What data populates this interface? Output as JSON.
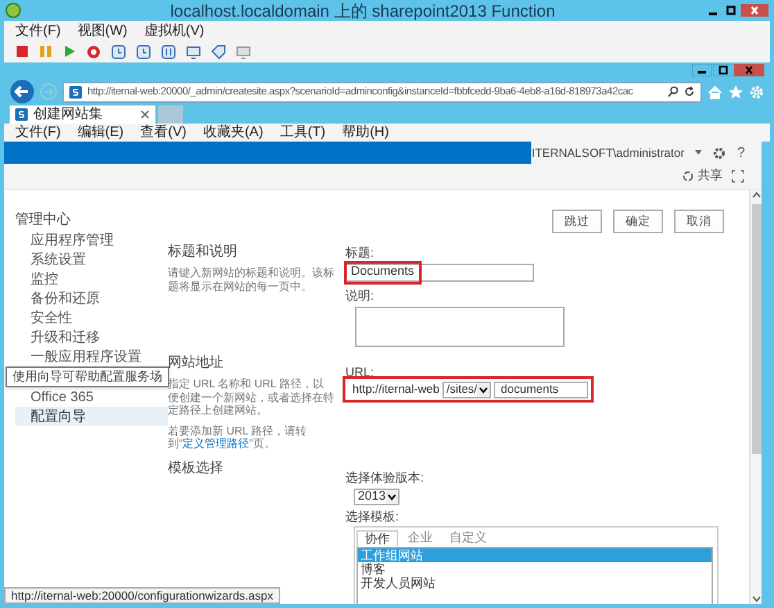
{
  "vm_window": {
    "title": "localhost.localdomain 上的 sharepoint2013 Function",
    "menu": [
      "文件(F)",
      "视图(W)",
      "虚拟机(V)"
    ]
  },
  "browser": {
    "url": "http://iternal-web:20000/_admin/createsite.aspx?scenarioId=adminconfig&instanceId=fbbfcedd-9ba6-4eb8-a16d-818973a42cac",
    "tabs": [
      {
        "label": "创建网站集",
        "selected": true
      }
    ],
    "menu": [
      "文件(F)",
      "编辑(E)",
      "查看(V)",
      "收藏夹(A)",
      "工具(T)",
      "帮助(H)"
    ],
    "status_url": "http://iternal-web:20000/configurationwizards.aspx"
  },
  "suite_bar": {
    "user": "ITERNALSOFT\\administrator",
    "help": "?",
    "share": "共享"
  },
  "nav": {
    "heading": "管理中心",
    "items": [
      {
        "label": "应用程序管理",
        "selected": false
      },
      {
        "label": "系统设置",
        "selected": false
      },
      {
        "label": "监控",
        "selected": false
      },
      {
        "label": "备份和还原",
        "selected": false
      },
      {
        "label": "安全性",
        "selected": false
      },
      {
        "label": "升级和迁移",
        "selected": false
      },
      {
        "label": "一般应用程序设置",
        "selected": false
      },
      {
        "label": "Office 365",
        "selected": false
      },
      {
        "label": "配置向导",
        "selected": true
      }
    ],
    "tooltip": "使用向导可帮助配置服务场"
  },
  "buttons": [
    "跳过",
    "确定",
    "取消"
  ],
  "sections": [
    {
      "heading": "标题和说明",
      "description": [
        "请键入新网站的标题和说明。该标题将显示在网站的每一页中。"
      ],
      "title_label": "标题:",
      "title_value": "Documents",
      "title_highlighted": true,
      "desc_label": "说明:"
    },
    {
      "heading": "网站地址",
      "description": [
        "指定 URL 名称和 URL 路径，以便创建一个新网站，或者选择在特定路径上创建网站。"
      ],
      "note_before": "若要添加新 URL 路径，请转到“",
      "note_link": "定义管理路径",
      "note_after": "”页。",
      "url_label": "URL:",
      "url_prefix": "http://iternal-web",
      "url_path": "/sites/",
      "url_value": "documents",
      "url_highlighted": true
    },
    {
      "heading": "模板选择",
      "version_label": "选择体验版本:",
      "version": "2013",
      "template_label": "选择模板:",
      "template_tabs": [
        {
          "label": "协作",
          "selected": true
        },
        {
          "label": "企业",
          "selected": false
        },
        {
          "label": "自定义",
          "selected": false
        }
      ],
      "templates": [
        {
          "label": "工作组网站",
          "selected": true
        },
        {
          "label": "博客",
          "selected": false
        },
        {
          "label": "开发人员网站",
          "selected": false
        }
      ]
    }
  ]
}
